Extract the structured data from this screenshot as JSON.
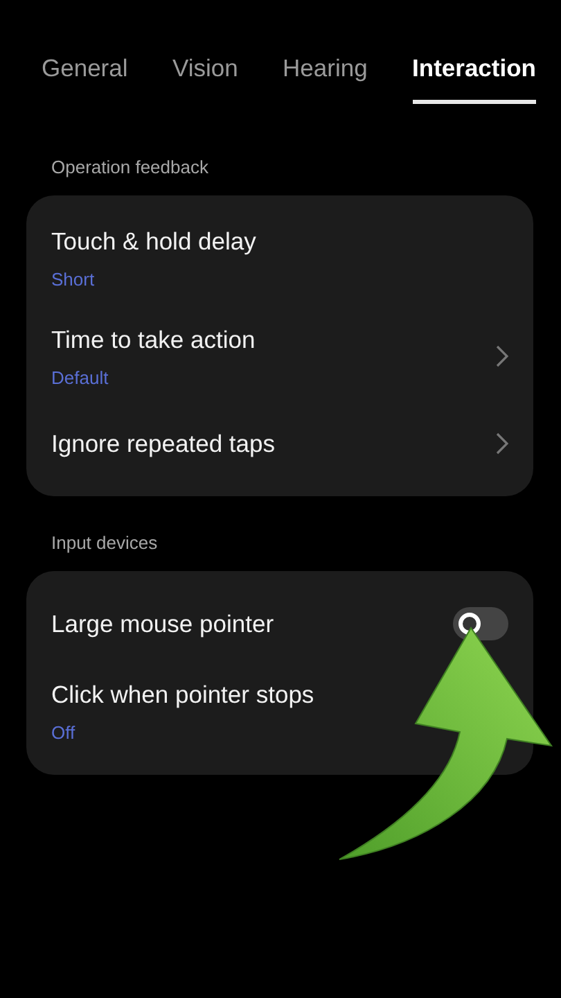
{
  "tabs": [
    {
      "label": "General",
      "selected": false
    },
    {
      "label": "Vision",
      "selected": false
    },
    {
      "label": "Hearing",
      "selected": false
    },
    {
      "label": "Interaction",
      "selected": true
    }
  ],
  "sections": [
    {
      "header": "Operation feedback",
      "items": [
        {
          "kind": "plain",
          "title": "Touch & hold delay",
          "value": "Short"
        },
        {
          "kind": "chevron",
          "title": "Time to take action",
          "value": "Default"
        },
        {
          "kind": "chevron",
          "title": "Ignore repeated taps"
        }
      ]
    },
    {
      "header": "Input devices",
      "items": [
        {
          "kind": "toggle",
          "title": "Large mouse pointer",
          "on": false
        },
        {
          "kind": "plain",
          "title": "Click when pointer stops",
          "value": "Off"
        }
      ]
    }
  ]
}
